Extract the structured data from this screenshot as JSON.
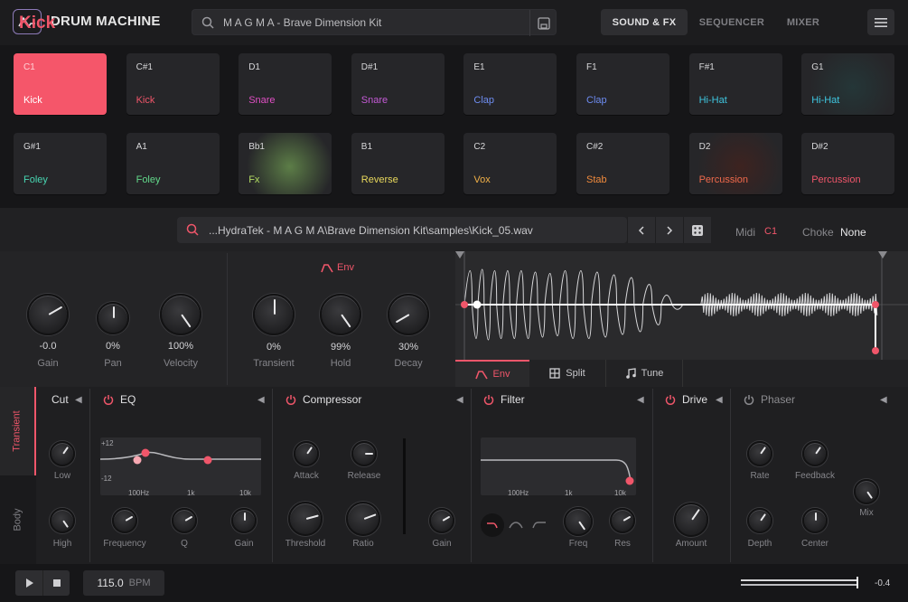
{
  "app": {
    "name": "DRUM MACHINE"
  },
  "search": {
    "value": "M A G M A - Brave Dimension Kit"
  },
  "nav": {
    "tabs": [
      "SOUND & FX",
      "SEQUENCER",
      "MIXER"
    ]
  },
  "pads": [
    {
      "note": "C1",
      "name": "Kick",
      "color": "#ffffff"
    },
    {
      "note": "C#1",
      "name": "Kick",
      "color": "#f0566a"
    },
    {
      "note": "D1",
      "name": "Snare",
      "color": "#e04fc4"
    },
    {
      "note": "D#1",
      "name": "Snare",
      "color": "#c45ad6"
    },
    {
      "note": "E1",
      "name": "Clap",
      "color": "#6f8ef2"
    },
    {
      "note": "F1",
      "name": "Clap",
      "color": "#6d8bf0"
    },
    {
      "note": "F#1",
      "name": "Hi-Hat",
      "color": "#3fc6e0"
    },
    {
      "note": "G1",
      "name": "Hi-Hat",
      "color": "#3fc6e0"
    },
    {
      "note": "G#1",
      "name": "Foley",
      "color": "#48d6b2"
    },
    {
      "note": "A1",
      "name": "Foley",
      "color": "#62d88a"
    },
    {
      "note": "Bb1",
      "name": "Fx",
      "color": "#b3db63"
    },
    {
      "note": "B1",
      "name": "Reverse",
      "color": "#e8d85c"
    },
    {
      "note": "C2",
      "name": "Vox",
      "color": "#f0b048"
    },
    {
      "note": "C#2",
      "name": "Stab",
      "color": "#f08a3c"
    },
    {
      "note": "D2",
      "name": "Percussion",
      "color": "#f06a4c"
    },
    {
      "note": "D#2",
      "name": "Percussion",
      "color": "#f0566a"
    }
  ],
  "instrument": {
    "name": "Kick",
    "path": "...HydraTek - M A G M A\\Brave Dimension Kit\\samples\\Kick_05.wav",
    "midi_label": "Midi",
    "midi_value": "C1",
    "choke_label": "Choke",
    "choke_value": "None"
  },
  "main_knobs": [
    {
      "label": "Gain",
      "value": "-0.0"
    },
    {
      "label": "Pan",
      "value": "0%"
    },
    {
      "label": "Velocity",
      "value": "100%"
    }
  ],
  "env": {
    "label": "Env",
    "knobs": [
      {
        "label": "Transient",
        "value": "0%"
      },
      {
        "label": "Hold",
        "value": "99%"
      },
      {
        "label": "Decay",
        "value": "30%"
      }
    ]
  },
  "wave_tabs": [
    "Env",
    "Split",
    "Tune"
  ],
  "side_tabs": [
    "Transient",
    "Body"
  ],
  "fx": {
    "cut": {
      "title": "Cut",
      "knobs": [
        "Low",
        "High"
      ]
    },
    "eq": {
      "title": "EQ",
      "ticks_y": [
        "+12",
        "-12"
      ],
      "ticks_x": [
        "100Hz",
        "1k",
        "10k"
      ],
      "knobs": [
        "Frequency",
        "Q",
        "Gain"
      ]
    },
    "compressor": {
      "title": "Compressor",
      "knobs": [
        "Attack",
        "Release",
        "Threshold",
        "Ratio",
        "Gain"
      ]
    },
    "filter": {
      "title": "Filter",
      "ticks_x": [
        "100Hz",
        "1k",
        "10k"
      ],
      "knobs": [
        "Freq",
        "Res"
      ]
    },
    "drive": {
      "title": "Drive",
      "knobs": [
        "Amount"
      ]
    },
    "phaser": {
      "title": "Phaser",
      "knobs": [
        "Rate",
        "Feedback",
        "Depth",
        "Center",
        "Mix"
      ]
    }
  },
  "transport": {
    "bpm_value": "115.0",
    "bpm_label": "BPM",
    "volume": "-0.4"
  },
  "colors": {
    "accent": "#f0566a",
    "bg": "#1b1b1d",
    "panel": "#242426"
  }
}
